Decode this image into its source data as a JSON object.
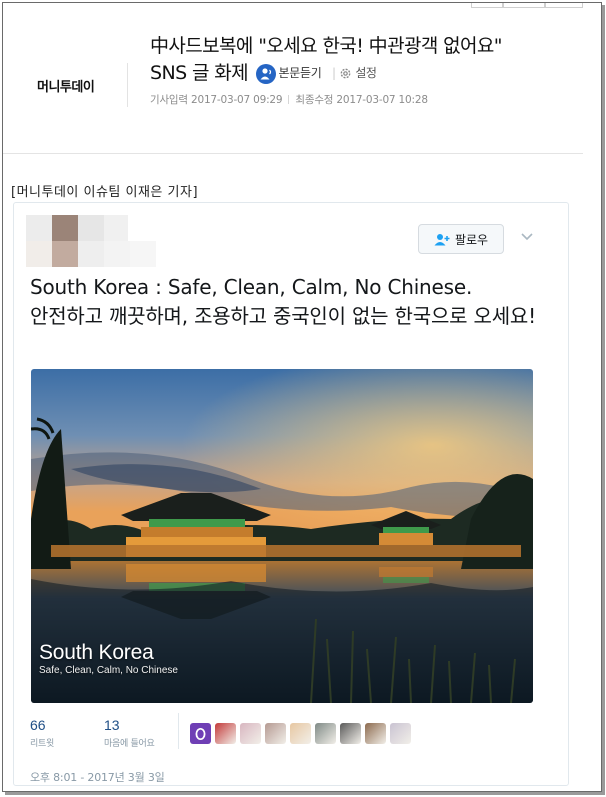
{
  "header": {
    "logo_text": "머니투데이",
    "headline_line1": "中사드보복에 \"오세요 한국! 中관광객 없어요\"",
    "headline_line2": "SNS 글 화제",
    "listen_label": "본문듣기",
    "settings_label": "설정",
    "published": "기사입력 2017-03-07 09:29",
    "modified": "최종수정 2017-03-07 10:28"
  },
  "article": {
    "byline": "[머니투데이 이슈팀 이재은 기자]"
  },
  "tweet": {
    "follow_label": "팔로우",
    "text_en": "South Korea : Safe, Clean, Calm, No Chinese.",
    "text_ko": "안전하고 깨끗하며, 조용하고 중국인이 없는 한국으로 오세요!",
    "photo_overlay_title": "South Korea",
    "photo_overlay_sub": "Safe, Clean, Calm, No Chinese",
    "retweets_count": "66",
    "retweets_label": "리트윗",
    "likes_count": "13",
    "likes_label": "마음에 들어요",
    "likers": [
      {
        "color": "#6f3fb5"
      },
      {
        "color": "#c33a3a"
      },
      {
        "color": "#d8b6c0"
      },
      {
        "color": "#b59a92"
      },
      {
        "color": "#e7c7a2"
      },
      {
        "color": "#7f8a86"
      },
      {
        "color": "#5a5a5a"
      },
      {
        "color": "#8c6a4e"
      },
      {
        "color": "#c9c3d2"
      }
    ],
    "timestamp": "오후 8:01 - 2017년 3월 3일"
  }
}
